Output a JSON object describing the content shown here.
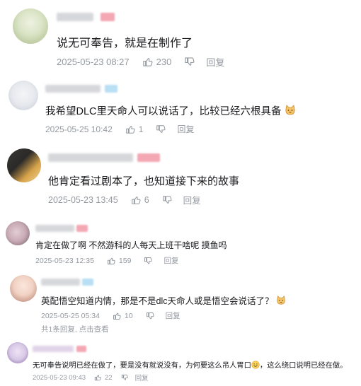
{
  "comments": [
    {
      "text": "说无可奉告，就是在制作了",
      "date": "2025-05-23 08:27",
      "likes": "230",
      "reply_label": "回复",
      "avatar_colors": [
        "#d9e3c4",
        "#8fa36a"
      ]
    },
    {
      "text": "我希望DLC里天命人可以说话了，比较已经六根具备",
      "date": "2025-05-25 10:42",
      "likes": "1",
      "reply_label": "回复",
      "avatar_colors": [
        "#e6e9ee",
        "#bcc3cc"
      ],
      "emoji": "cat-emoji"
    },
    {
      "text": "他肯定看过剧本了，也知道接下来的故事",
      "date": "2025-05-23 13:45",
      "likes": "6",
      "reply_label": "回复",
      "avatar_colors": [
        "#2b2a28",
        "#d8a44a"
      ]
    },
    {
      "text": "肯定在做了啊 不然游科的人每天上班干啥呢 摸鱼吗",
      "date": "2025-05-23 12:35",
      "likes": "159",
      "reply_label": "回复",
      "avatar_colors": [
        "#c7a9b4",
        "#6e5a63"
      ]
    },
    {
      "text": "英配悟空知道内情，那是不是dlc天命人或是悟空会说话了？",
      "date": "2025-05-25 05:34",
      "likes": "10",
      "reply_label": "回复",
      "avatar_colors": [
        "#f1d2c4",
        "#b27b6a"
      ],
      "emoji": "cat-emoji",
      "sub_reply": "共1条回复, 点击查看"
    },
    {
      "text_a": "无可奉告说明已经在做了，要是没有就说没有，为何要这么吊人胃口",
      "text_b": "，这么绕口说明已经在做。",
      "date": "2025-05-23 09:43",
      "likes": "22",
      "reply_label": "回复",
      "avatar_colors": [
        "#d8c9e6",
        "#8a6aa8"
      ],
      "emoji": "grin-emoji"
    }
  ]
}
